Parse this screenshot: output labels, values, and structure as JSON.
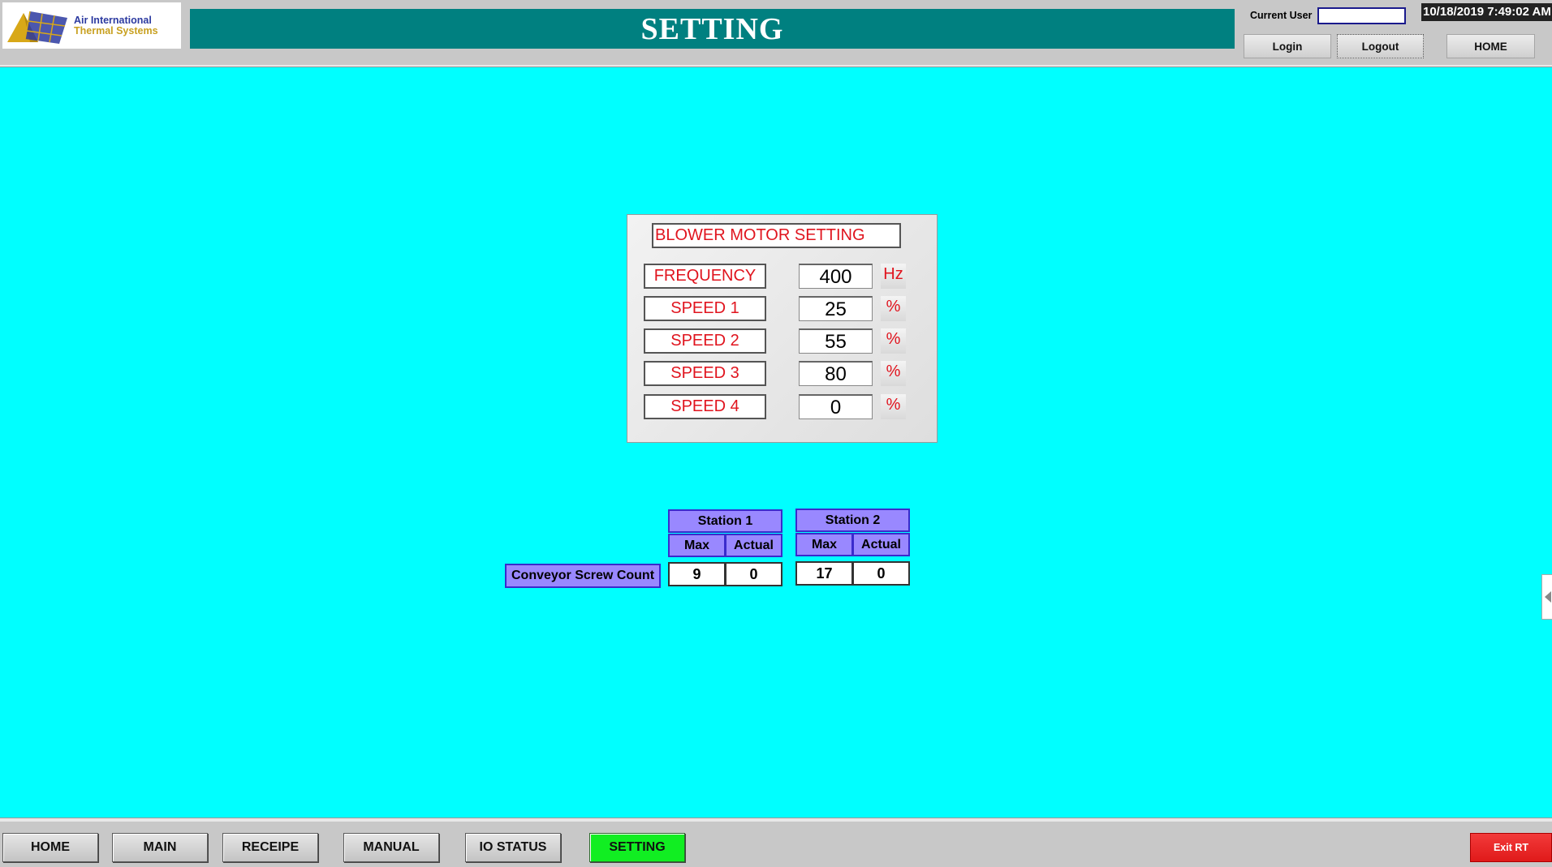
{
  "header": {
    "logo_line1": "Air International",
    "logo_line2": "Thermal Systems",
    "title": "SETTING",
    "current_user_label": "Current User",
    "current_user_value": "",
    "datetime": "10/18/2019 7:49:02 AM",
    "login_label": "Login",
    "logout_label": "Logout",
    "home_label": "HOME"
  },
  "blower_panel": {
    "title": "BLOWER MOTOR SETTING",
    "params": [
      {
        "label": "FREQUENCY",
        "value": "400",
        "unit": "Hz"
      },
      {
        "label": "SPEED 1",
        "value": "25",
        "unit": "%"
      },
      {
        "label": "SPEED 2",
        "value": "55",
        "unit": "%"
      },
      {
        "label": "SPEED 3",
        "value": "80",
        "unit": "%"
      },
      {
        "label": "SPEED 4",
        "value": "0",
        "unit": "%"
      }
    ]
  },
  "conveyor": {
    "row_label": "Conveyor Screw Count",
    "stations": [
      {
        "name": "Station 1",
        "max_label": "Max",
        "actual_label": "Actual",
        "max": "9",
        "actual": "0"
      },
      {
        "name": "Station 2",
        "max_label": "Max",
        "actual_label": "Actual",
        "max": "17",
        "actual": "0"
      }
    ]
  },
  "footer": {
    "nav": [
      "HOME",
      "MAIN",
      "RECEIPE",
      "MANUAL",
      "IO STATUS",
      "SETTING"
    ],
    "active": "SETTING",
    "exit_label": "Exit RT"
  },
  "colors": {
    "background": "#00ffff",
    "title_bar": "#008080",
    "accent_red": "#e0141e",
    "station_header": "#9988ff",
    "active_nav": "#11ee22",
    "exit_button": "#e01a1a"
  },
  "icons": [
    "logo-icon",
    "chevron-left-icon"
  ]
}
